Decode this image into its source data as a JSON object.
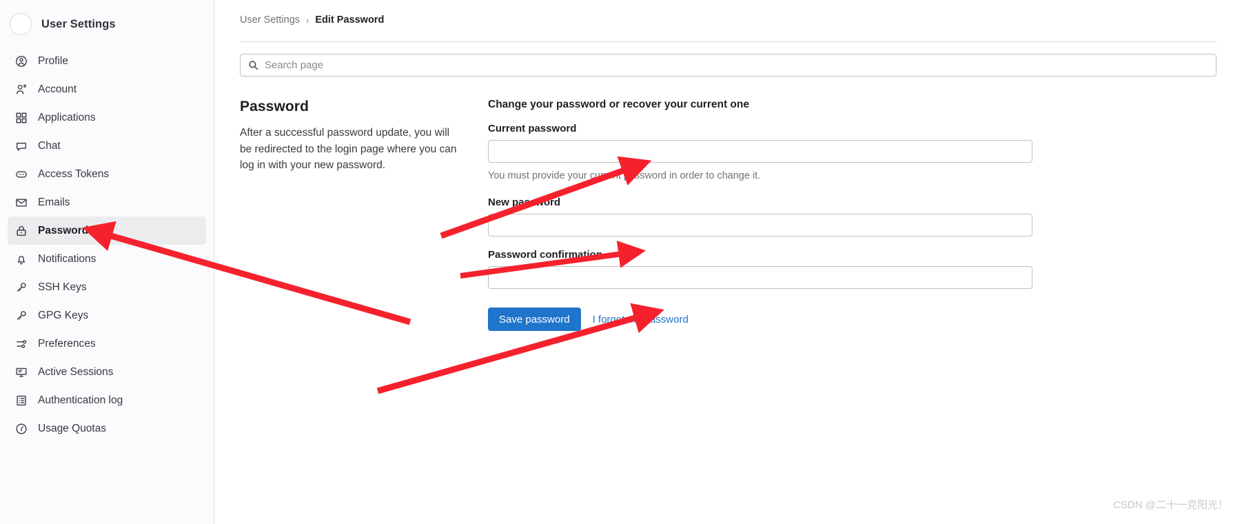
{
  "sidebar": {
    "title": "User Settings",
    "items": [
      {
        "label": "Profile",
        "icon": "user-circle-icon",
        "active": false
      },
      {
        "label": "Account",
        "icon": "user-gear-icon",
        "active": false
      },
      {
        "label": "Applications",
        "icon": "grid-apps-icon",
        "active": false
      },
      {
        "label": "Chat",
        "icon": "chat-bubble-icon",
        "active": false
      },
      {
        "label": "Access Tokens",
        "icon": "token-icon",
        "active": false
      },
      {
        "label": "Emails",
        "icon": "envelope-icon",
        "active": false
      },
      {
        "label": "Password",
        "icon": "lock-icon",
        "active": true
      },
      {
        "label": "Notifications",
        "icon": "bell-icon",
        "active": false
      },
      {
        "label": "SSH Keys",
        "icon": "key-icon",
        "active": false
      },
      {
        "label": "GPG Keys",
        "icon": "key-icon",
        "active": false
      },
      {
        "label": "Preferences",
        "icon": "sliders-icon",
        "active": false
      },
      {
        "label": "Active Sessions",
        "icon": "monitor-icon",
        "active": false
      },
      {
        "label": "Authentication log",
        "icon": "list-log-icon",
        "active": false
      },
      {
        "label": "Usage Quotas",
        "icon": "gauge-icon",
        "active": false
      }
    ]
  },
  "breadcrumb": {
    "parent": "User Settings",
    "separator": "›",
    "current": "Edit Password"
  },
  "search": {
    "placeholder": "Search page",
    "value": "",
    "icon": "search-icon"
  },
  "section": {
    "title": "Password",
    "description": "After a successful password update, you will be redirected to the login page where you can log in with your new password."
  },
  "form": {
    "heading": "Change your password or recover your current one",
    "fields": [
      {
        "label": "Current password",
        "value": "",
        "help": "You must provide your current password in order to change it."
      },
      {
        "label": "New password",
        "value": "",
        "help": ""
      },
      {
        "label": "Password confirmation",
        "value": "",
        "help": ""
      }
    ],
    "submit_label": "Save password",
    "forgot_label": "I forgot my password"
  },
  "watermark": "CSDN @二十一克阳光！",
  "colors": {
    "accent": "#1f75cb",
    "annotation": "#f5222d",
    "active_bg": "#ececef",
    "sidebar_bg": "#fbfafd",
    "border": "#dcdcde"
  }
}
